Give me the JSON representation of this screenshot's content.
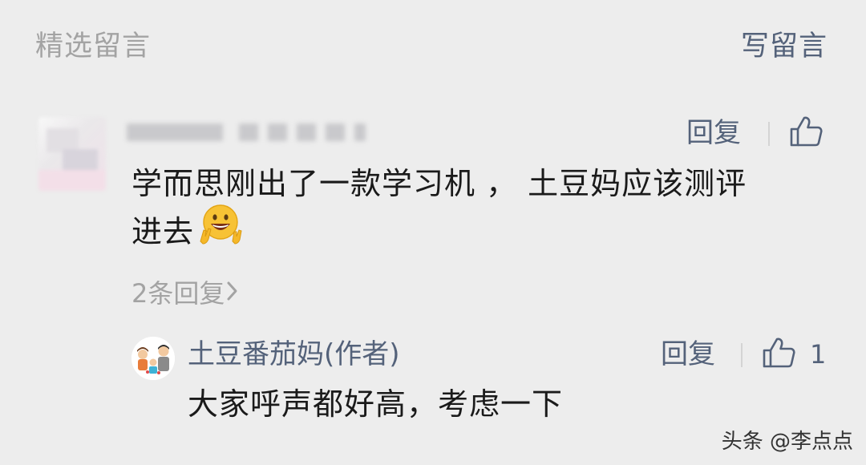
{
  "header": {
    "title": "精选留言",
    "write_label": "写留言"
  },
  "comment": {
    "text_line1": "学而思刚出了一款学习机 ， 土豆妈应该测评",
    "text_line2": "进去",
    "emoji": "grinning-peace-emoji",
    "reply_label": "回复",
    "replies_count_label": "2条回复"
  },
  "author_reply": {
    "name": "土豆番茄妈(作者)",
    "text": "大家呼声都好高，考虑一下",
    "reply_label": "回复",
    "like_count": "1"
  },
  "watermark": "头条 @李点点",
  "colors": {
    "background": "#ededed",
    "link": "#54627a",
    "muted": "#a3a3a3",
    "text": "#1a1a1a"
  }
}
